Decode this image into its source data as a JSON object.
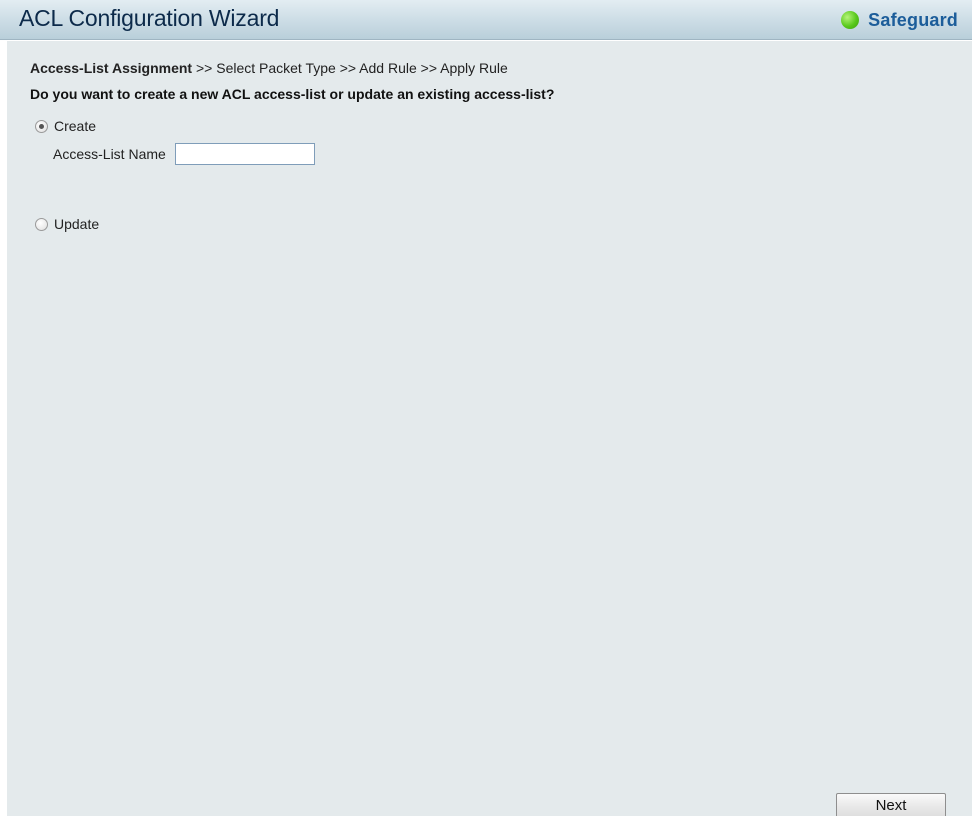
{
  "header": {
    "title": "ACL Configuration Wizard",
    "safeguard_label": "Safeguard",
    "safeguard_status_color": "#58c81b"
  },
  "breadcrumb": {
    "current_step": "Access-List Assignment",
    "remaining_steps": ">> Select Packet Type >> Add Rule >> Apply Rule"
  },
  "question": "Do you want to create a new ACL access-list or update an existing access-list?",
  "options": {
    "create": {
      "label": "Create",
      "selected": true
    },
    "update": {
      "label": "Update",
      "selected": false
    }
  },
  "access_list_name": {
    "label": "Access-List Name",
    "value": "",
    "placeholder": ""
  },
  "buttons": {
    "next_label": "Next"
  }
}
